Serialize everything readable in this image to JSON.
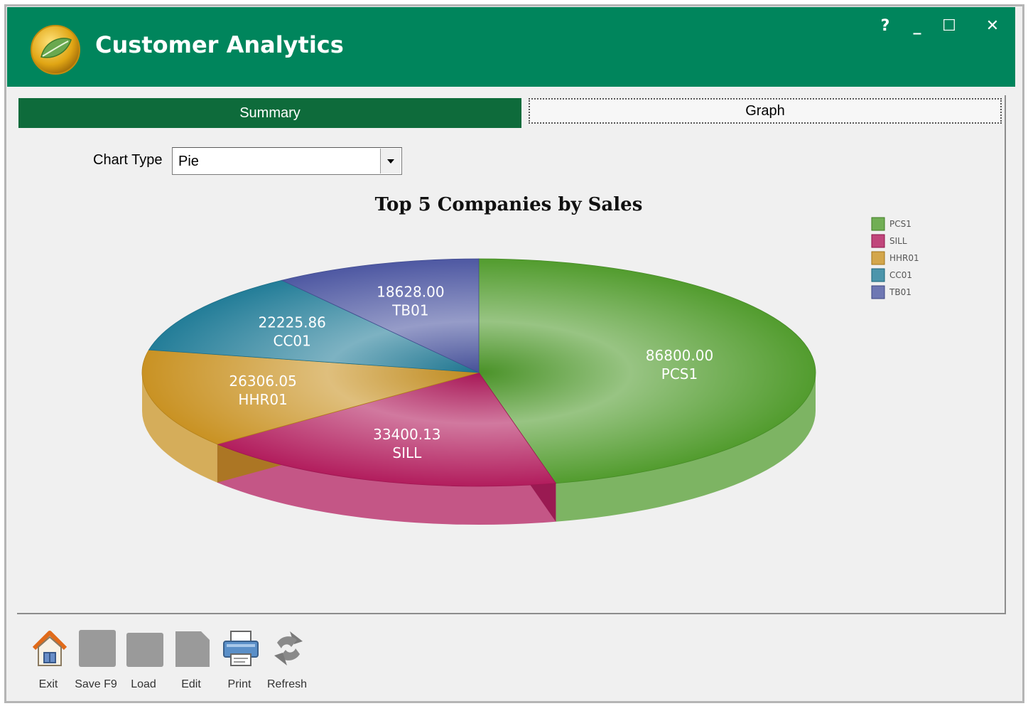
{
  "app": {
    "title": "Customer Analytics"
  },
  "window_controls": {
    "help": "?",
    "minimize": "_",
    "maximize": "☐",
    "close": "✕"
  },
  "tabs": [
    {
      "label": "Summary",
      "active": true
    },
    {
      "label": "Graph",
      "active": false
    }
  ],
  "chart_type": {
    "label": "Chart Type",
    "value": "Pie"
  },
  "toolbar": [
    {
      "label": "Exit",
      "icon": "home-icon"
    },
    {
      "label": "Save F9",
      "icon": "save-icon"
    },
    {
      "label": "Load",
      "icon": "load-icon"
    },
    {
      "label": "Edit",
      "icon": "edit-icon"
    },
    {
      "label": "Print",
      "icon": "printer-icon"
    },
    {
      "label": "Refresh",
      "icon": "refresh-icon"
    }
  ],
  "chart_data": {
    "type": "pie",
    "style": "3d",
    "title": "Top 5 Companies by Sales",
    "categories": [
      "PCS1",
      "SILL",
      "HHR01",
      "CC01",
      "TB01"
    ],
    "values": [
      86800.0,
      33400.13,
      26306.05,
      22225.86,
      18628.0
    ],
    "value_labels": [
      "86800.00",
      "33400.13",
      "26306.05",
      "22225.86",
      "18628.00"
    ],
    "colors": [
      "#4e9a2a",
      "#b0185a",
      "#c8901e",
      "#1f7a96",
      "#4a55a0"
    ],
    "legend": {
      "position": "top-right",
      "entries": [
        "PCS1",
        "SILL",
        "HHR01",
        "CC01",
        "TB01"
      ]
    }
  }
}
